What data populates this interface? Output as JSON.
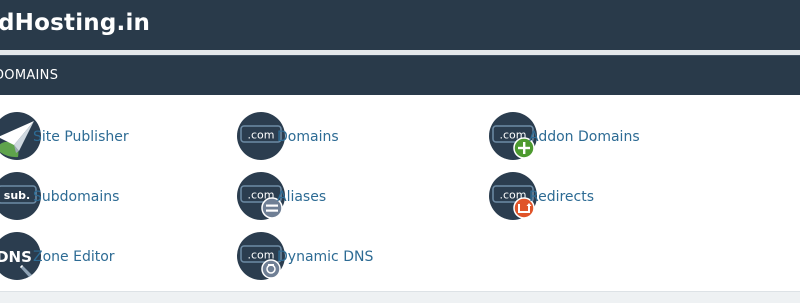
{
  "header": {
    "brand": "dHosting.in"
  },
  "section": {
    "title": "DOMAINS",
    "items": [
      {
        "label": "Site Publisher",
        "icon": "site-publisher-icon"
      },
      {
        "label": "Domains",
        "icon": "domains-icon"
      },
      {
        "label": "Addon Domains",
        "icon": "addon-domains-icon"
      },
      {
        "label": "Subdomains",
        "icon": "subdomains-icon"
      },
      {
        "label": "Aliases",
        "icon": "aliases-icon"
      },
      {
        "label": "Redirects",
        "icon": "redirects-icon"
      },
      {
        "label": "Zone Editor",
        "icon": "zone-editor-icon"
      },
      {
        "label": "Dynamic DNS",
        "icon": "dynamic-dns-icon"
      }
    ],
    "icon_text": {
      "com": ".com",
      "sub": "sub.",
      "dns": "DNS"
    }
  },
  "colors": {
    "header_bg": "#293a4a",
    "link": "#2d6b94",
    "icon_circle": "#2b3d4f",
    "addon_badge": "#4d9a2f",
    "redirect_badge": "#e0552a",
    "alias_badge": "#6f7f95"
  }
}
